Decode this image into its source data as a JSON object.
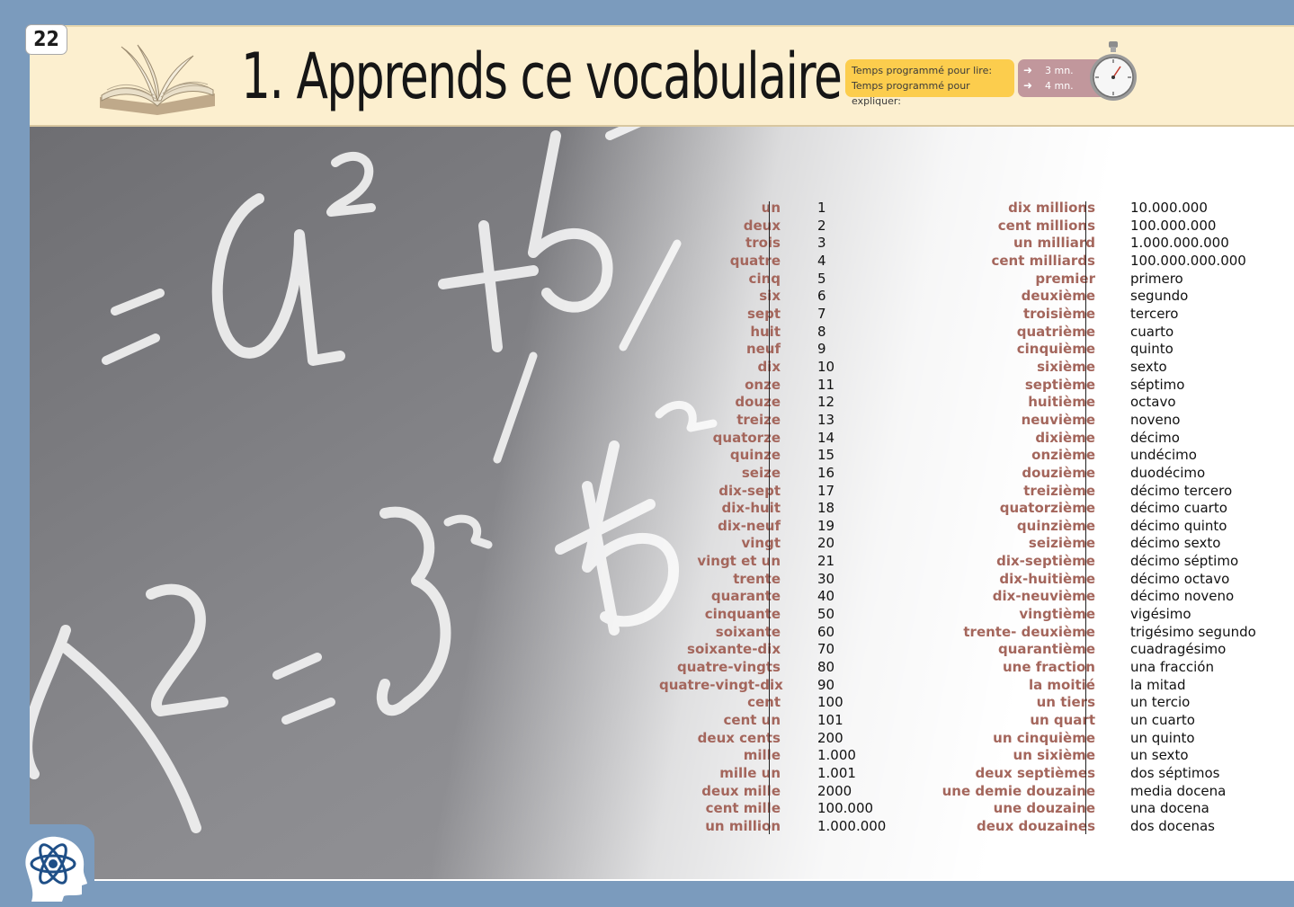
{
  "header": {
    "page_number": "22",
    "title": "1. Apprends ce vocabulaire",
    "timer": {
      "read_label": "Temps programmé pour lire:",
      "explain_label": "Temps programmé pour expliquer:",
      "read_value": "3 mn.",
      "explain_value": "4 mn."
    }
  },
  "colors": {
    "page_background": "#7b9bbd",
    "header_background": "#fcefcf",
    "timer_labels_background": "#fccd4d",
    "timer_values_background": "#c1979c",
    "french_word": "#a4665c",
    "translation": "#111111"
  },
  "icons": [
    "open-book-icon",
    "arrow-right-icon",
    "stopwatch-icon",
    "atom-head-icon"
  ],
  "vocabulary_left": [
    {
      "fr": "un",
      "value": "1"
    },
    {
      "fr": "deux",
      "value": "2"
    },
    {
      "fr": "trois",
      "value": "3"
    },
    {
      "fr": "quatre",
      "value": "4"
    },
    {
      "fr": "cinq",
      "value": "5"
    },
    {
      "fr": "six",
      "value": "6"
    },
    {
      "fr": "sept",
      "value": "7"
    },
    {
      "fr": "huit",
      "value": "8"
    },
    {
      "fr": "neuf",
      "value": "9"
    },
    {
      "fr": "dix",
      "value": "10"
    },
    {
      "fr": "onze",
      "value": "11"
    },
    {
      "fr": "douze",
      "value": "12"
    },
    {
      "fr": "treize",
      "value": "13"
    },
    {
      "fr": "quatorze",
      "value": "14"
    },
    {
      "fr": "quinze",
      "value": "15"
    },
    {
      "fr": "seize",
      "value": "16"
    },
    {
      "fr": "dix-sept",
      "value": "17"
    },
    {
      "fr": "dix-huit",
      "value": "18"
    },
    {
      "fr": "dix-neuf",
      "value": "19"
    },
    {
      "fr": "vingt",
      "value": "20"
    },
    {
      "fr": "vingt et un",
      "value": "21"
    },
    {
      "fr": "trente",
      "value": "30"
    },
    {
      "fr": "quarante",
      "value": "40"
    },
    {
      "fr": "cinquante",
      "value": "50"
    },
    {
      "fr": "soixante",
      "value": "60"
    },
    {
      "fr": "soixante-dix",
      "value": "70"
    },
    {
      "fr": "quatre-vingts",
      "value": "80"
    },
    {
      "fr": "quatre-vingt-dix",
      "value": "90"
    },
    {
      "fr": "cent",
      "value": "100"
    },
    {
      "fr": "cent un",
      "value": "101"
    },
    {
      "fr": "deux cents",
      "value": "200"
    },
    {
      "fr": "mille",
      "value": "1.000"
    },
    {
      "fr": "mille un",
      "value": "1.001"
    },
    {
      "fr": "deux mille",
      "value": "2000"
    },
    {
      "fr": "cent mille",
      "value": "100.000"
    },
    {
      "fr": "un million",
      "value": "1.000.000"
    }
  ],
  "vocabulary_right": [
    {
      "fr": "dix millions",
      "value": "10.000.000"
    },
    {
      "fr": "cent millions",
      "value": "100.000.000"
    },
    {
      "fr": "un milliard",
      "value": "1.000.000.000"
    },
    {
      "fr": "cent milliards",
      "value": "100.000.000.000"
    },
    {
      "fr": "premier",
      "value": "primero"
    },
    {
      "fr": "deuxième",
      "value": "segundo"
    },
    {
      "fr": "troisième",
      "value": "tercero"
    },
    {
      "fr": "quatrième",
      "value": "cuarto"
    },
    {
      "fr": "cinquième",
      "value": "quinto"
    },
    {
      "fr": "sixième",
      "value": "sexto"
    },
    {
      "fr": "septième",
      "value": "séptimo"
    },
    {
      "fr": "huitième",
      "value": "octavo"
    },
    {
      "fr": "neuvième",
      "value": "noveno"
    },
    {
      "fr": "dixième",
      "value": "décimo"
    },
    {
      "fr": "onzième",
      "value": "undécimo"
    },
    {
      "fr": "douzième",
      "value": "duodécimo"
    },
    {
      "fr": "treizième",
      "value": "décimo tercero"
    },
    {
      "fr": "quatorzième",
      "value": "décimo cuarto"
    },
    {
      "fr": "quinzième",
      "value": "décimo quinto"
    },
    {
      "fr": "seizième",
      "value": "décimo sexto"
    },
    {
      "fr": "dix-septième",
      "value": "décimo séptimo"
    },
    {
      "fr": "dix-huitième",
      "value": "décimo octavo"
    },
    {
      "fr": "dix-neuvième",
      "value": "décimo noveno"
    },
    {
      "fr": "vingtième",
      "value": "vigésimo"
    },
    {
      "fr": "trente- deuxième",
      "value": "trigésimo segundo"
    },
    {
      "fr": "quarantième",
      "value": "cuadragésimo"
    },
    {
      "fr": "une fraction",
      "value": "una fracción"
    },
    {
      "fr": "la moitié",
      "value": "la mitad"
    },
    {
      "fr": "un tiers",
      "value": "un tercio"
    },
    {
      "fr": "un quart",
      "value": "un cuarto"
    },
    {
      "fr": "un cinquième",
      "value": "un quinto"
    },
    {
      "fr": "un sixième",
      "value": "un sexto"
    },
    {
      "fr": "deux septièmes",
      "value": "dos séptimos"
    },
    {
      "fr": "une demie douzaine",
      "value": "media docena"
    },
    {
      "fr": "une douzaine",
      "value": "una docena"
    },
    {
      "fr": "deux douzaines",
      "value": "dos docenas"
    }
  ]
}
